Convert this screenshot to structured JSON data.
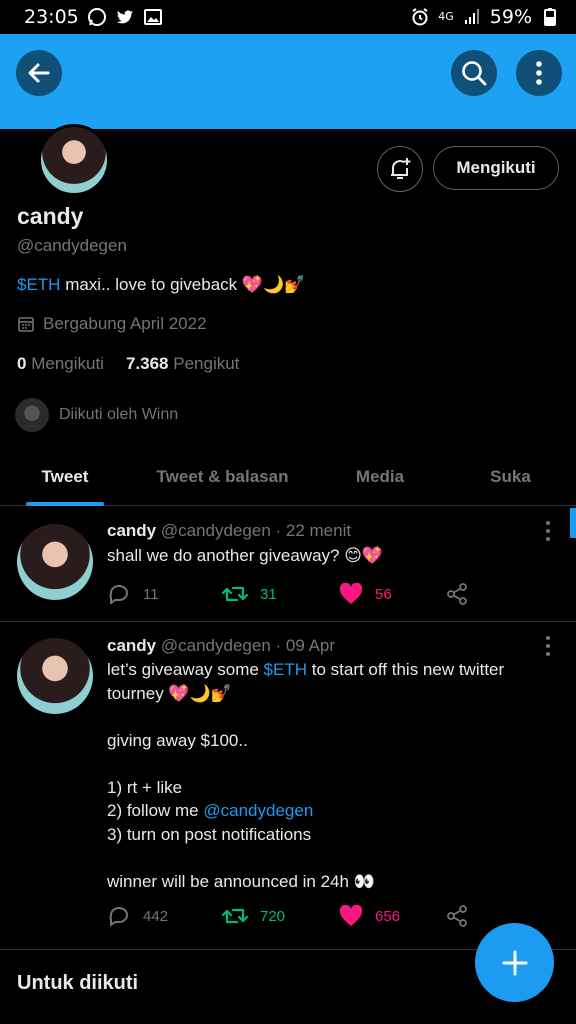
{
  "status_bar": {
    "time": "23:05",
    "network": "4G",
    "battery": "59%"
  },
  "profile": {
    "name": "candy",
    "handle": "@candydegen",
    "bio_link": "$ETH",
    "bio_text": " maxi.. love to giveback 💖🌙💅",
    "joined": "Bergabung April 2022",
    "following_count": "0",
    "following_label": "Mengikuti",
    "followers_count": "7.368",
    "followers_label": "Pengikut",
    "followed_by": "Diikuti oleh Winn",
    "follow_button": "Mengikuti"
  },
  "tabs": [
    "Tweet",
    "Tweet & balasan",
    "Media",
    "Suka"
  ],
  "tweets": [
    {
      "name": "candy",
      "meta": "@candydegen · 22 menit",
      "text": "shall we do another giveaway? 😊💖",
      "replies": "11",
      "retweets": "31",
      "likes": "56"
    },
    {
      "name": "candy",
      "meta": "@candydegen · 09 Apr",
      "text_1": "let’s giveaway some ",
      "text_link_1": "$ETH",
      "text_2": " to start off this new twitter tourney 💖🌙💅\n\ngiving away $100..\n\n1) rt + like\n2) follow me ",
      "text_link_2": "@candydegen",
      "text_3": "\n3) turn on post notifications\n\nwinner will be announced in 24h 👀",
      "replies": "442",
      "retweets": "720",
      "likes": "656"
    }
  ],
  "suggest_title": "Untuk diikuti",
  "colors": {
    "banner": "#1da1f2",
    "accent": "#1d9bf0",
    "retweet": "#00ba7c",
    "like": "#f91880"
  }
}
